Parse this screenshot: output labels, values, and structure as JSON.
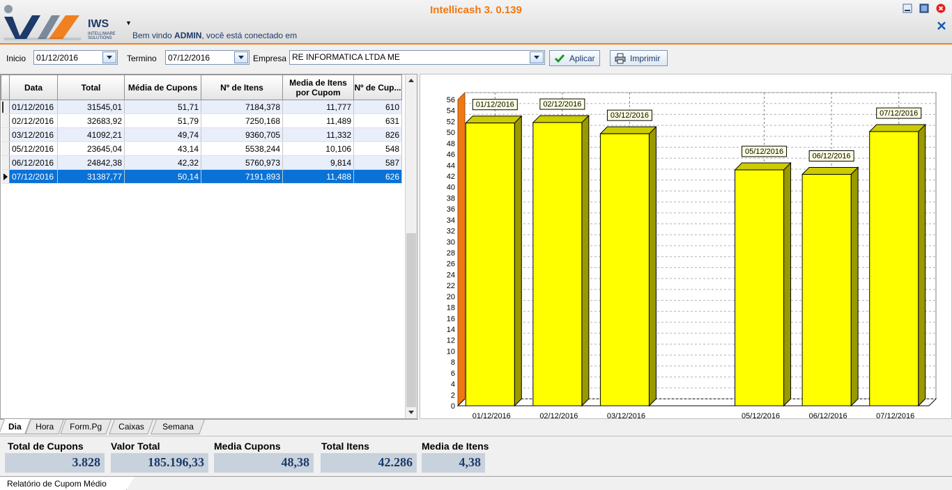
{
  "header": {
    "app_title": "Intellicash 3. 0.139",
    "brand": "IWS",
    "brand_sub": "INTELLIWARE SOLUTIONS",
    "welcome_prefix": "Bem vindo ",
    "welcome_user": "ADMIN",
    "welcome_suffix": ", você está conectado em",
    "colors": {
      "accent": "#f07810",
      "brand": "#1c3a6a"
    }
  },
  "filters": {
    "inicio_label": "Inicio",
    "inicio_value": "01/12/2016",
    "termino_label": "Termino",
    "termino_value": "07/12/2016",
    "empresa_label": "Empresa",
    "empresa_value": "RE INFORMATICA LTDA ME",
    "aplicar_label": "Aplicar",
    "imprimir_label": "Imprimir"
  },
  "grid": {
    "columns": [
      "Data",
      "Total",
      "Média de Cupons",
      "Nº de Itens",
      "Media de Itens por Cupom",
      "Nº de Cup..."
    ],
    "rows": [
      [
        "01/12/2016",
        "31545,01",
        "51,71",
        "7184,378",
        "11,777",
        "610"
      ],
      [
        "02/12/2016",
        "32683,92",
        "51,79",
        "7250,168",
        "11,489",
        "631"
      ],
      [
        "03/12/2016",
        "41092,21",
        "49,74",
        "9360,705",
        "11,332",
        "826"
      ],
      [
        "05/12/2016",
        "23645,04",
        "43,14",
        "5538,244",
        "10,106",
        "548"
      ],
      [
        "06/12/2016",
        "24842,38",
        "42,32",
        "5760,973",
        "9,814",
        "587"
      ],
      [
        "07/12/2016",
        "31387,77",
        "50,14",
        "7191,893",
        "11,488",
        "626"
      ]
    ],
    "selected_row": 5
  },
  "tabs": [
    "Dia",
    "Hora",
    "Form.Pg",
    "Caixas",
    "Semana"
  ],
  "active_tab": 0,
  "chart_data": {
    "type": "bar",
    "categories": [
      "01/12/2016",
      "02/12/2016",
      "03/12/2016",
      "",
      "05/12/2016",
      "06/12/2016",
      "07/12/2016"
    ],
    "values": [
      51.71,
      51.79,
      49.74,
      null,
      43.14,
      42.32,
      50.14
    ],
    "ylim": [
      0,
      56
    ],
    "yticks": [
      0,
      2,
      4,
      6,
      8,
      10,
      12,
      14,
      16,
      18,
      20,
      22,
      24,
      26,
      28,
      30,
      32,
      34,
      36,
      38,
      40,
      42,
      44,
      46,
      48,
      50,
      52,
      54,
      56
    ],
    "grid": true,
    "bar_color": "#ffff00",
    "style": "3d"
  },
  "totals": [
    {
      "label": "Total de Cupons",
      "value": "3.828"
    },
    {
      "label": "Valor Total",
      "value": "185.196,33"
    },
    {
      "label": "Media Cupons",
      "value": "48,38"
    },
    {
      "label": "Total Itens",
      "value": "42.286"
    },
    {
      "label": "Media de Itens",
      "value": "4,38"
    }
  ],
  "doc_tab": "Relatório de Cupom Médio"
}
